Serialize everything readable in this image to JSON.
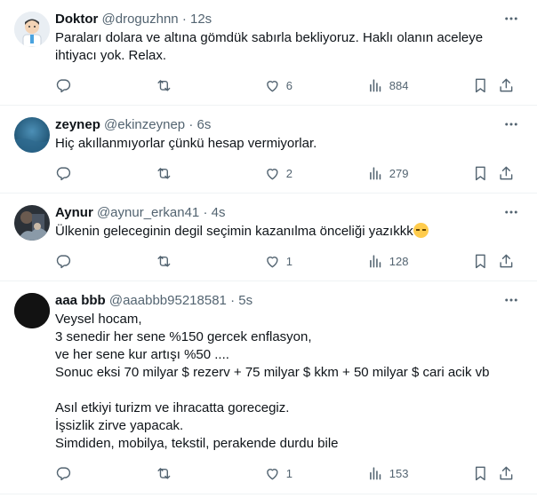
{
  "tweets": [
    {
      "name": "Doktor",
      "handle": "@droguzhnn",
      "sep": "·",
      "time": "12s",
      "text": "Paraları dolara ve altına gömdük sabırla bekliyoruz. Haklı olanın aceleye\nihtiyacı yok. Relax.",
      "replies": "",
      "retweets": "",
      "likes": "6",
      "views": "884",
      "avatar_icon": "doctor-cartoon-avatar"
    },
    {
      "name": "zeynep",
      "handle": "@ekinzeynep",
      "sep": "·",
      "time": "6s",
      "text": "Hiç akıllanmıyorlar çünkü hesap vermiyorlar.",
      "replies": "",
      "retweets": "",
      "likes": "2",
      "views": "279",
      "avatar_icon": "blue-water-avatar"
    },
    {
      "name": "Aynur",
      "handle": "@aynur_erkan41",
      "sep": "·",
      "time": "4s",
      "text": "Ülkenin geleceginin degil seçimin kazanılma önceliği yazıkkk",
      "emoji": "pensive-face-emoji",
      "replies": "",
      "retweets": "",
      "likes": "1",
      "views": "128",
      "avatar_icon": "photo-avatar"
    },
    {
      "name": "aaa bbb",
      "handle": "@aaabbb95218581",
      "sep": "·",
      "time": "5s",
      "text": "Veysel hocam,\n3 senedir her sene %150 gercek enflasyon,\nve her sene kur artışı %50 ....\nSonuc eksi 70 milyar $ rezerv + 75 milyar $ kkm + 50 milyar $ cari acik vb\n\nAsıl etkiyi turizm ve ihracatta gorecegiz.\nİşsizlik zirve yapacak.\nSimdiden, mobilya, tekstil, perakende durdu bile",
      "replies": "",
      "retweets": "",
      "likes": "1",
      "views": "153",
      "avatar_icon": "black-avatar"
    }
  ],
  "colors": {
    "secondary_text": "#536471",
    "primary_text": "#0f1419",
    "divider": "#eff3f4"
  }
}
